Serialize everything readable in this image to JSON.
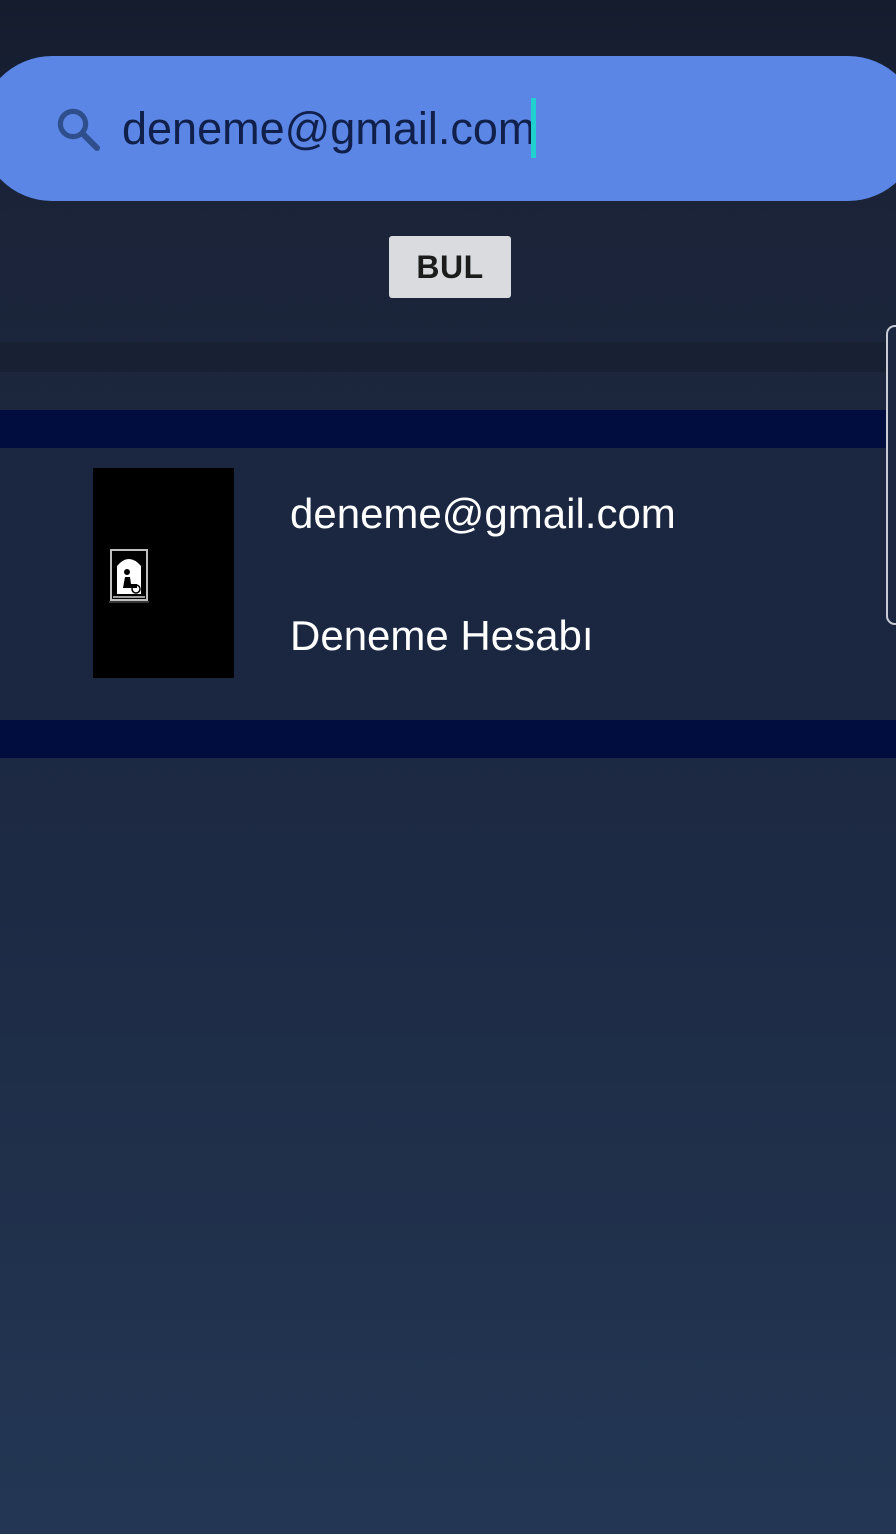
{
  "search": {
    "value": "deneme@gmail.com",
    "icon": "search-icon",
    "colors": {
      "bar": "#5b86e5",
      "cursor": "#1fd2d0"
    }
  },
  "find_button": {
    "label": "BUL"
  },
  "results": [
    {
      "email": "deneme@gmail.com",
      "name": "Deneme Hesabı",
      "avatar": "profile-photo"
    }
  ]
}
